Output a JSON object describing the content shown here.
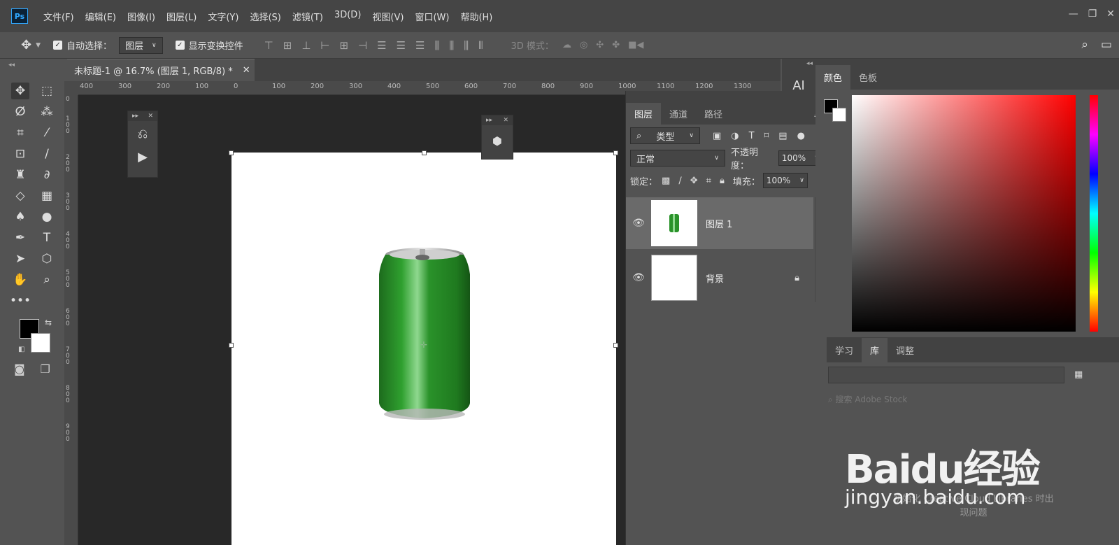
{
  "app": {
    "logo": "Ps"
  },
  "menu": [
    "文件(F)",
    "编辑(E)",
    "图像(I)",
    "图层(L)",
    "文字(Y)",
    "选择(S)",
    "滤镜(T)",
    "3D(D)",
    "视图(V)",
    "窗口(W)",
    "帮助(H)"
  ],
  "options": {
    "auto_select_label": "自动选择：",
    "auto_select_value": "图层",
    "show_transform_label": "显示变换控件",
    "mode3d_label": "3D 模式："
  },
  "document": {
    "tab_title": "未标题-1 @ 16.7% (图层 1, RGB/8) *",
    "ruler_h": [
      "400",
      "300",
      "200",
      "100",
      "0",
      "100",
      "200",
      "300",
      "400",
      "500",
      "600",
      "700",
      "800",
      "900",
      "1000",
      "1100",
      "1200",
      "1300"
    ],
    "ruler_v": [
      "0",
      "100",
      "200",
      "300",
      "400",
      "500",
      "600",
      "700",
      "800",
      "900"
    ]
  },
  "layers_panel": {
    "tabs": [
      "图层",
      "通道",
      "路径"
    ],
    "filter_kind": "类型",
    "blend_mode": "正常",
    "opacity_label": "不透明度：",
    "opacity_value": "100%",
    "lock_label": "锁定：",
    "fill_label": "填充：",
    "fill_value": "100%",
    "layers": [
      {
        "name": "图层 1",
        "selected": true
      },
      {
        "name": "背景",
        "locked": true
      }
    ]
  },
  "right_strip": {
    "label": "AI"
  },
  "color_panel": {
    "tabs": [
      "颜色",
      "色板"
    ],
    "fg": "#000000",
    "bg": "#ffffff"
  },
  "lib_panel": {
    "tabs": [
      "学习",
      "库",
      "调整"
    ],
    "search_placeholder": "搜索 Adobe Stock",
    "message": "初始化 Creative Cloud Libraries 时出现问题"
  },
  "watermark": {
    "line1": "Baidu经验",
    "line2": "jingyan.baidu.com"
  }
}
